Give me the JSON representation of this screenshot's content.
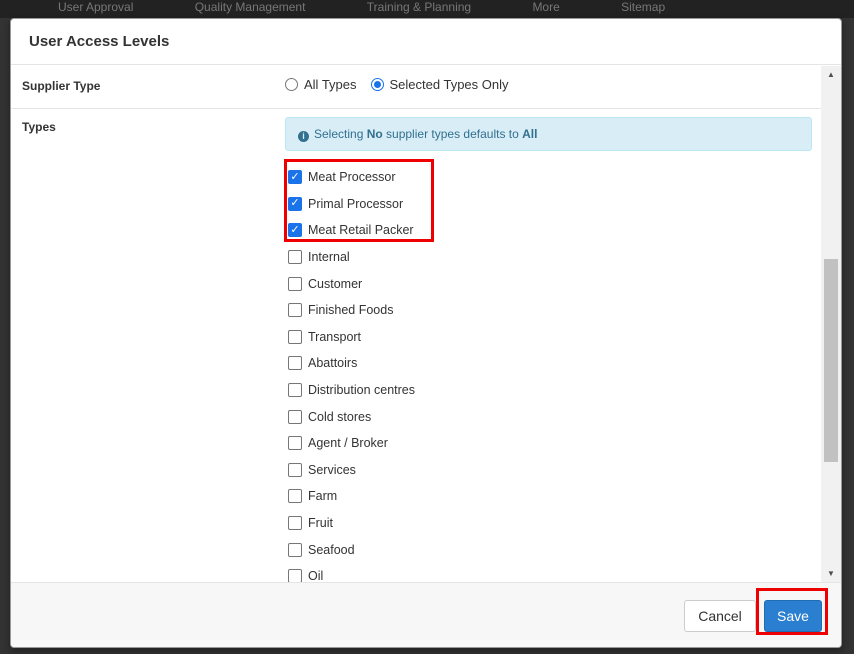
{
  "background_nav": [
    "User Approval",
    "Quality Management",
    "Training & Planning",
    "More",
    "Sitemap"
  ],
  "modal": {
    "title": "User Access Levels",
    "supplier_type": {
      "label": "Supplier Type",
      "options": [
        {
          "label": "All Types",
          "selected": false
        },
        {
          "label": "Selected Types Only",
          "selected": true
        }
      ]
    },
    "types": {
      "label": "Types",
      "info": {
        "prefix": "Selecting ",
        "bold1": "No",
        "middle": " supplier types defaults to ",
        "bold2": "All"
      },
      "items": [
        {
          "label": "Meat Processor",
          "checked": true
        },
        {
          "label": "Primal Processor",
          "checked": true
        },
        {
          "label": "Meat Retail Packer",
          "checked": true
        },
        {
          "label": "Internal",
          "checked": false
        },
        {
          "label": "Customer",
          "checked": false
        },
        {
          "label": "Finished Foods",
          "checked": false
        },
        {
          "label": "Transport",
          "checked": false
        },
        {
          "label": "Abattoirs",
          "checked": false
        },
        {
          "label": "Distribution centres",
          "checked": false
        },
        {
          "label": "Cold stores",
          "checked": false
        },
        {
          "label": "Agent / Broker",
          "checked": false
        },
        {
          "label": "Services",
          "checked": false
        },
        {
          "label": "Farm",
          "checked": false
        },
        {
          "label": "Fruit",
          "checked": false
        },
        {
          "label": "Seafood",
          "checked": false
        },
        {
          "label": "Oil",
          "checked": false
        }
      ]
    },
    "footer": {
      "cancel_label": "Cancel",
      "save_label": "Save"
    }
  },
  "colors": {
    "accent": "#1a73e8",
    "save_button": "#2a7fd0",
    "highlight": "#ee0000",
    "info_bg": "#d9edf7"
  }
}
